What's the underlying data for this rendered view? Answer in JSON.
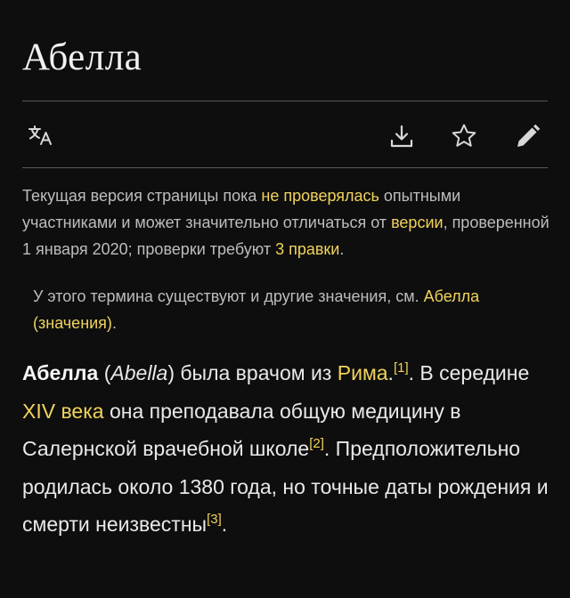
{
  "page": {
    "title": "Абелла"
  },
  "toolbar": {
    "language_icon": "translate-icon",
    "download_icon": "download-icon",
    "watch_icon": "star-icon",
    "edit_icon": "pencil-icon"
  },
  "notice": {
    "part1": "Текущая версия страницы пока ",
    "link1": "не проверялась",
    "part2": " опытными участниками и может значительно отличаться от ",
    "link2": "версии",
    "part3": ", проверенной 1 января 2020; проверки требуют ",
    "link3": "3 правки",
    "part4": "."
  },
  "hatnote": {
    "text": "У этого термина существуют и другие значения, см. ",
    "link": "Абелла (значения)",
    "end": "."
  },
  "article": {
    "bold_name": "Абелла",
    "paren_open": " (",
    "latin_name": "Abella",
    "seg1": ") была врачом из ",
    "link_rome": "Рима",
    "dot1": ".",
    "ref1": "[1]",
    "seg2": ". В середине ",
    "link_century": "XIV века",
    "seg3": " она преподавала общую медицину в Салернской врачебной школе",
    "ref2": "[2]",
    "seg4": ". Предположительно родилась около 1380 года, но точные даты рождения и смерти неизвестны",
    "ref3": "[3]",
    "seg5": "."
  },
  "colors": {
    "background": "#0e0e0f",
    "link": "#f0d35a",
    "text": "#e9e9e9",
    "muted_text": "#bdbdbd"
  }
}
